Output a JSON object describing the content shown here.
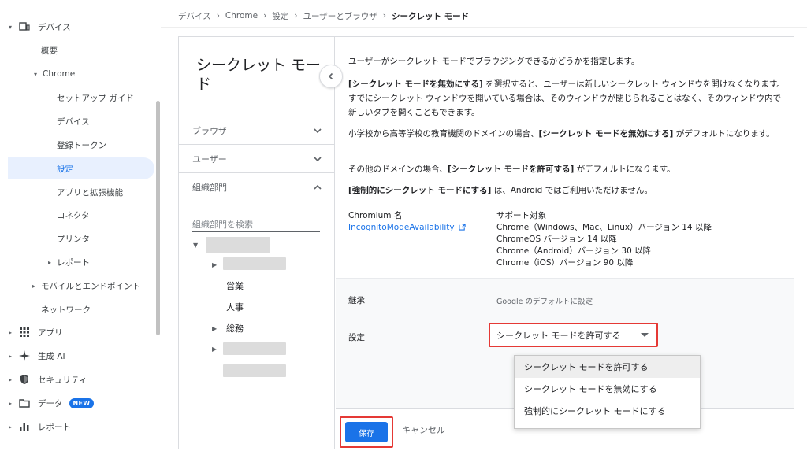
{
  "nav": {
    "items": [
      {
        "label": "デバイス",
        "icon": "devices-icon",
        "caret": "▾"
      },
      {
        "label": "概要"
      },
      {
        "label": "Chrome",
        "caret": "▾"
      },
      {
        "label": "セットアップ ガイド"
      },
      {
        "label": "デバイス"
      },
      {
        "label": "登録トークン"
      },
      {
        "label": "設定"
      },
      {
        "label": "アプリと拡張機能"
      },
      {
        "label": "コネクタ"
      },
      {
        "label": "プリンタ"
      },
      {
        "label": "レポート",
        "caret": "▸"
      },
      {
        "label": "モバイルとエンドポイント",
        "caret": "▸"
      },
      {
        "label": "ネットワーク"
      },
      {
        "label": "アプリ",
        "icon": "apps-grid-icon",
        "caret": "▸"
      },
      {
        "label": "生成 AI",
        "icon": "sparkle-icon",
        "caret": "▸"
      },
      {
        "label": "セキュリティ",
        "icon": "shield-icon",
        "caret": "▸"
      },
      {
        "label": "データ",
        "icon": "folder-icon",
        "caret": "▸",
        "badge": "NEW"
      },
      {
        "label": "レポート",
        "icon": "bar-chart-icon",
        "caret": "▸"
      }
    ]
  },
  "breadcrumb": {
    "items": [
      "デバイス",
      "Chrome",
      "設定",
      "ユーザーとブラウザ"
    ],
    "current": "シークレット モード",
    "separator": "›"
  },
  "left_panel": {
    "title": "シークレット モード",
    "sections": [
      "ブラウザ",
      "ユーザー",
      "組織部門"
    ],
    "search_placeholder": "組織部門を検索",
    "tree_items": [
      "営業",
      "人事",
      "総務"
    ]
  },
  "content": {
    "intro": "ユーザーがシークレット モードでブラウジングできるかどうかを指定します。",
    "p2_bold": "[シークレット モードを無効にする]",
    "p2_rest": " を選択すると、ユーザーは新しいシークレット ウィンドウを開けなくなります。すでにシークレット ウィンドウを開いている場合は、そのウィンドウが閉じられることはなく、そのウィンドウ内で新しいタブを開くこともできます。",
    "p3_pre": "小学校から高等学校の教育機関のドメインの場合、",
    "p3_bold": "[シークレット モードを無効にする]",
    "p3_post": " がデフォルトになります。",
    "p4_pre": "その他のドメインの場合、",
    "p4_bold": "[シークレット モードを許可する]",
    "p4_post": " がデフォルトになります。",
    "p5_bold": "[強制的にシークレット モードにする]",
    "p5_post": " は、Android ではご利用いただけません。",
    "chromium_label": "Chromium 名",
    "policy_name": "IncognitoModeAvailability",
    "support_label": "サポート対象",
    "support_lines": [
      "Chrome（Windows、Mac、Linux）バージョン 14 以降",
      "ChromeOS バージョン 14 以降",
      "Chrome（Android）バージョン 30 以降",
      "Chrome（iOS）バージョン 90 以降"
    ],
    "inherit_label": "継承",
    "inherit_value": "Google のデフォルトに設定",
    "setting_label": "設定",
    "selected_value": "シークレット モードを許可する",
    "options": [
      "シークレット モードを許可する",
      "シークレット モードを無効にする",
      "強制的にシークレット モードにする"
    ],
    "save": "保存",
    "cancel": "キャンセル"
  },
  "colors": {
    "accent": "#1a73e8",
    "highlight_border": "#e53935",
    "active_nav_bg": "#e8f0fe"
  }
}
